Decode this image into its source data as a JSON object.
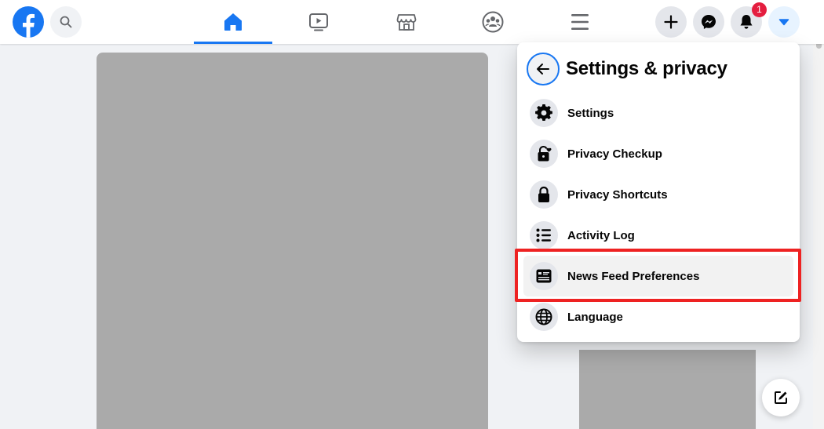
{
  "colors": {
    "brand": "#1877f2",
    "badge": "#e41e3f",
    "highlight": "#ee2222",
    "placeholder": "#aaaaaa"
  },
  "topbar": {
    "logo_icon": "facebook-logo-icon",
    "search_icon": "search-icon",
    "tabs": [
      {
        "icon": "home-icon",
        "active": true
      },
      {
        "icon": "watch-icon",
        "active": false
      },
      {
        "icon": "marketplace-icon",
        "active": false
      },
      {
        "icon": "groups-icon",
        "active": false
      },
      {
        "icon": "menu-icon",
        "active": false
      }
    ],
    "notifications_badge": "1"
  },
  "dropdown": {
    "title": "Settings & privacy",
    "items": [
      {
        "label": "Settings",
        "icon": "gear-icon"
      },
      {
        "label": "Privacy Checkup",
        "icon": "lock-heart-icon"
      },
      {
        "label": "Privacy Shortcuts",
        "icon": "lock-icon"
      },
      {
        "label": "Activity Log",
        "icon": "list-icon"
      },
      {
        "label": "News Feed Preferences",
        "icon": "news-feed-icon"
      },
      {
        "label": "Language",
        "icon": "globe-icon"
      }
    ]
  }
}
